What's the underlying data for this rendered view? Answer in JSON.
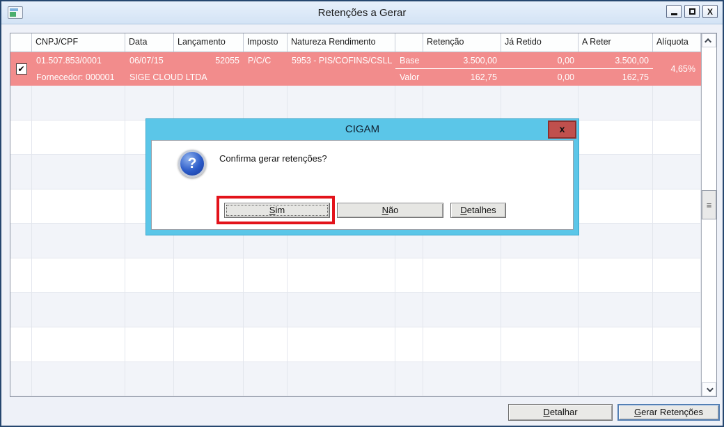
{
  "window": {
    "title": "Retenções a Gerar",
    "controls": {
      "close_glyph": "X"
    }
  },
  "table": {
    "columns": [
      "",
      "CNPJ/CPF",
      "Data",
      "Lançamento",
      "Imposto",
      "Natureza Rendimento",
      "",
      "Retenção",
      "Já Retido",
      "A Reter",
      "Alíquota"
    ],
    "empty_row_count": 9,
    "row": {
      "checked": true,
      "check_glyph": "✔",
      "cnpj": "01.507.853/0001",
      "data": "06/07/15",
      "lancamento": "52055",
      "imposto": "P/C/C",
      "natureza": "5953 - PIS/COFINS/CSLL",
      "fornecedor": "Fornecedor: 000001",
      "fornecedor_nome": "SIGE CLOUD LTDA",
      "base_label": "Base",
      "base_retencao": "3.500,00",
      "base_ja_retido": "0,00",
      "base_a_reter": "3.500,00",
      "valor_label": "Valor",
      "valor_retencao": "162,75",
      "valor_ja_retido": "0,00",
      "valor_a_reter": "162,75",
      "aliquota": "4,65%"
    },
    "scrollbar": {
      "grip_glyph": "≡"
    }
  },
  "dialog": {
    "title": "CIGAM",
    "close_glyph": "x",
    "message": "Confirma gerar retenções?",
    "buttons": [
      {
        "accel": "S",
        "rest": "im"
      },
      {
        "accel": "N",
        "rest": "ão"
      },
      {
        "accel": "D",
        "rest": "etalhes"
      }
    ]
  },
  "footer": {
    "detalhar": {
      "accel": "D",
      "rest": "etalhar"
    },
    "gerar": {
      "accel": "G",
      "rest": "erar Retenções"
    }
  },
  "colors": {
    "accent_pink": "#F28C8C",
    "dialog_cyan": "#5BC6E8",
    "annotation_red": "#E3131B",
    "close_red": "#C0504D",
    "titlebar_blue": "#E7F0FB",
    "window_bg": "#EEF1F8",
    "row_alt": "#F2F4F9",
    "focus_blue": "#537FB4"
  }
}
